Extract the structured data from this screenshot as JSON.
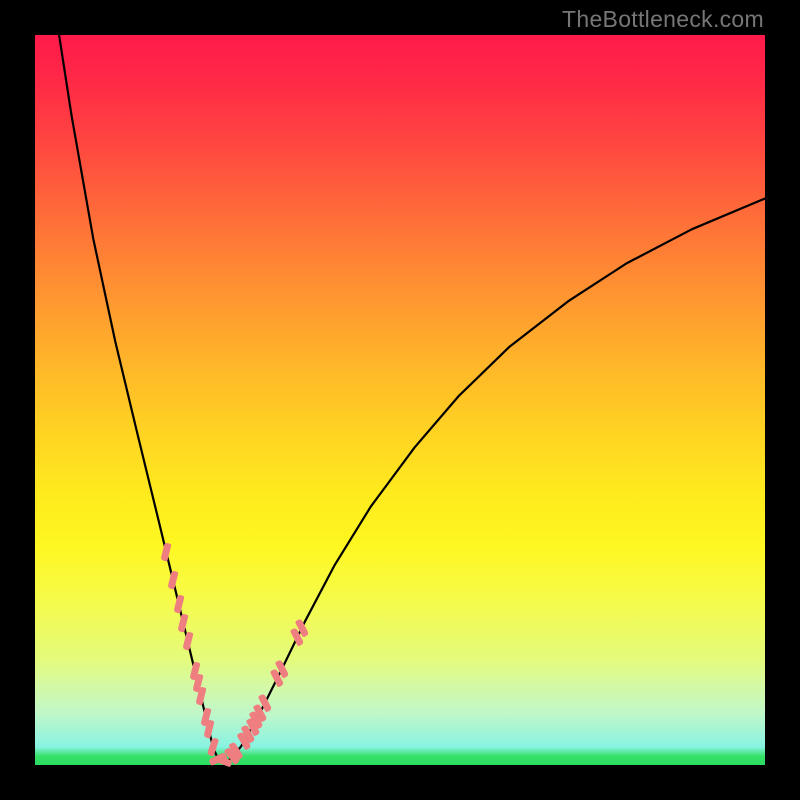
{
  "watermark": "TheBottleneck.com",
  "colors": {
    "frame": "#000000",
    "grad_top": "#ff1a4a",
    "grad_bottom": "#2adc5e",
    "curve": "#000000",
    "marker": "#ef7e80"
  },
  "chart_data": {
    "type": "line",
    "title": "",
    "xlabel": "",
    "ylabel": "",
    "xlim": [
      0,
      100
    ],
    "ylim": [
      0,
      100
    ],
    "series": [
      {
        "name": "curve",
        "x": [
          3.3,
          5,
          8,
          11,
          14,
          17,
          19.2,
          21,
          22.5,
          23.6,
          24.4,
          25.2,
          26.4,
          28.2,
          30.5,
          33.5,
          37,
          41,
          46,
          52,
          58,
          65,
          73,
          81,
          90,
          100
        ],
        "values": [
          100,
          89,
          72,
          58,
          45.5,
          33.2,
          24.1,
          16.6,
          10.4,
          5.7,
          2.4,
          0.5,
          0.5,
          2.5,
          6.5,
          12.5,
          19.7,
          27.3,
          35.4,
          43.5,
          50.5,
          57.3,
          63.5,
          68.7,
          73.4,
          77.6
        ],
        "color": "#000000"
      }
    ],
    "markers": [
      {
        "x": 18.0,
        "y": 29.2,
        "rot": -76
      },
      {
        "x": 18.9,
        "y": 25.3,
        "rot": -76
      },
      {
        "x": 19.7,
        "y": 22.0,
        "rot": -76
      },
      {
        "x": 20.3,
        "y": 19.5,
        "rot": -76
      },
      {
        "x": 20.9,
        "y": 17.0,
        "rot": -76
      },
      {
        "x": 21.9,
        "y": 12.9,
        "rot": -76
      },
      {
        "x": 22.3,
        "y": 11.2,
        "rot": -76
      },
      {
        "x": 22.7,
        "y": 9.5,
        "rot": -76
      },
      {
        "x": 23.4,
        "y": 6.6,
        "rot": -76
      },
      {
        "x": 23.8,
        "y": 4.9,
        "rot": -76
      },
      {
        "x": 24.4,
        "y": 2.4,
        "rot": -72
      },
      {
        "x": 25.0,
        "y": 0.8,
        "rot": -25
      },
      {
        "x": 25.8,
        "y": 0.5,
        "rot": 20
      },
      {
        "x": 27.0,
        "y": 1.2,
        "rot": 50
      },
      {
        "x": 27.6,
        "y": 1.9,
        "rot": 58
      },
      {
        "x": 28.6,
        "y": 3.3,
        "rot": 60
      },
      {
        "x": 29.2,
        "y": 4.2,
        "rot": 61
      },
      {
        "x": 29.8,
        "y": 5.2,
        "rot": 62
      },
      {
        "x": 30.3,
        "y": 6.1,
        "rot": 62
      },
      {
        "x": 30.8,
        "y": 7.1,
        "rot": 62
      },
      {
        "x": 31.5,
        "y": 8.5,
        "rot": 63
      },
      {
        "x": 33.2,
        "y": 11.9,
        "rot": 63
      },
      {
        "x": 33.8,
        "y": 13.1,
        "rot": 63
      },
      {
        "x": 35.9,
        "y": 17.5,
        "rot": 63
      },
      {
        "x": 36.6,
        "y": 18.8,
        "rot": 63
      }
    ]
  }
}
